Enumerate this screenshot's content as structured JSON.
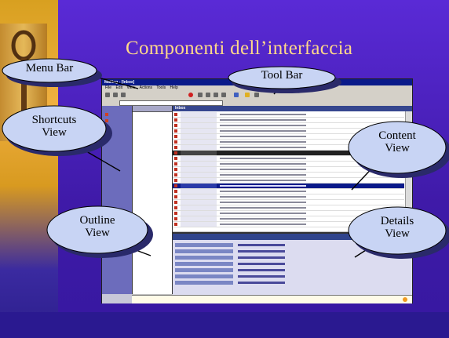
{
  "slide": {
    "title": "Componenti dell’interfaccia",
    "colors": {
      "background": "#4a22c0",
      "title": "#ffd88a",
      "callout_fill": "#c8d4f4",
      "callout_shadow": "#2a2a6a"
    }
  },
  "callouts": {
    "menu_bar": "Menu Bar",
    "tool_bar": "Tool Bar",
    "shortcuts_line1": "Shortcuts",
    "shortcuts_line2": "View",
    "content_line1": "Content",
    "content_line2": "View",
    "outline_line1": "Outline",
    "outline_line2": "View",
    "details_line1": "Details",
    "details_line2": "View"
  },
  "app": {
    "window_title": "Mailing - [Inbox]",
    "menu_items": [
      "File",
      "Edit",
      "View",
      "Actions",
      "Tools",
      "Help"
    ],
    "content_header": "Inbox",
    "icons": [
      "folder-icon",
      "message-icon",
      "toolbar-button-icon",
      "info-icon"
    ]
  }
}
